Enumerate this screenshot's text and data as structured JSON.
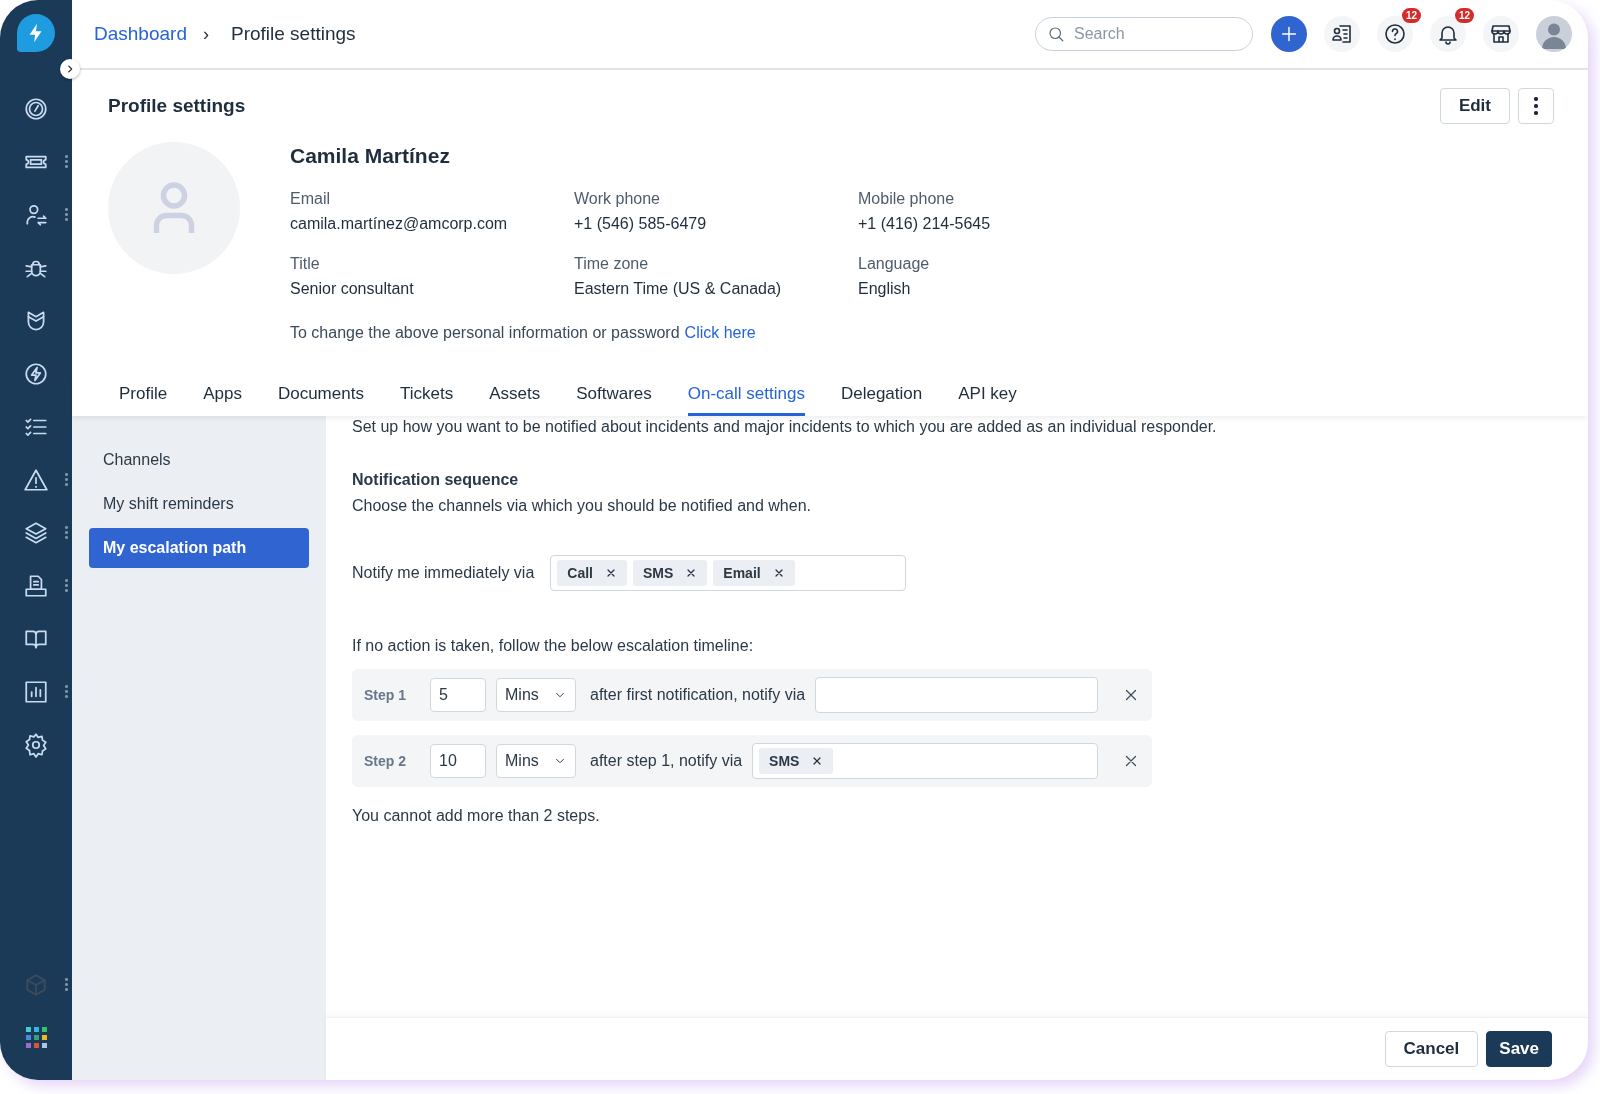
{
  "breadcrumb": {
    "link": "Dashboard",
    "separator": "›",
    "current": "Profile settings"
  },
  "search": {
    "placeholder": "Search"
  },
  "header_badges": {
    "help": "12",
    "notifications": "12"
  },
  "profile": {
    "title": "Profile settings",
    "edit_button": "Edit",
    "name": "Camila Martínez",
    "fields": [
      {
        "label": "Email",
        "value": "camila.martínez@amcorp.com"
      },
      {
        "label": "Work phone",
        "value": "+1 (546) 585-6479"
      },
      {
        "label": "Mobile phone",
        "value": "+1 (416) 214-5645"
      },
      {
        "label": "Title",
        "value": "Senior consultant"
      },
      {
        "label": "Time zone",
        "value": "Eastern Time (US & Canada)"
      },
      {
        "label": "Language",
        "value": "English"
      }
    ],
    "note": "To change the above personal information or password",
    "note_link": "Click here"
  },
  "tabs": [
    {
      "label": "Profile",
      "selected": false
    },
    {
      "label": "Apps",
      "selected": false
    },
    {
      "label": "Documents",
      "selected": false
    },
    {
      "label": "Tickets",
      "selected": false
    },
    {
      "label": "Assets",
      "selected": false
    },
    {
      "label": "Softwares",
      "selected": false
    },
    {
      "label": "On-call settings",
      "selected": true
    },
    {
      "label": "Delegation",
      "selected": false
    },
    {
      "label": "API key",
      "selected": false
    }
  ],
  "side_nav": [
    {
      "label": "Channels",
      "selected": false
    },
    {
      "label": "My shift reminders",
      "selected": false
    },
    {
      "label": "My escalation path",
      "selected": true
    }
  ],
  "content": {
    "intro": "Set up how you want to be notified about incidents and major incidents to which you are added as an individual responder.",
    "heading": "Notification sequence",
    "description": "Choose the channels via which you should be notified and when.",
    "notify_label": "Notify me immediately via",
    "notify_channels": [
      "Call",
      "SMS",
      "Email"
    ],
    "timeline_label": "If no action is taken, follow the below escalation timeline:",
    "steps": [
      {
        "label": "Step 1",
        "amount": "5",
        "unit": "Mins",
        "text": "after first notification, notify via"
      },
      {
        "label": "Step 2",
        "amount": "10",
        "unit": "Mins",
        "text": "after step 1, notify via",
        "channels": [
          "SMS"
        ]
      }
    ],
    "limit_note": "You cannot add more than 2 steps."
  },
  "footer": {
    "cancel": "Cancel",
    "save": "Save"
  }
}
